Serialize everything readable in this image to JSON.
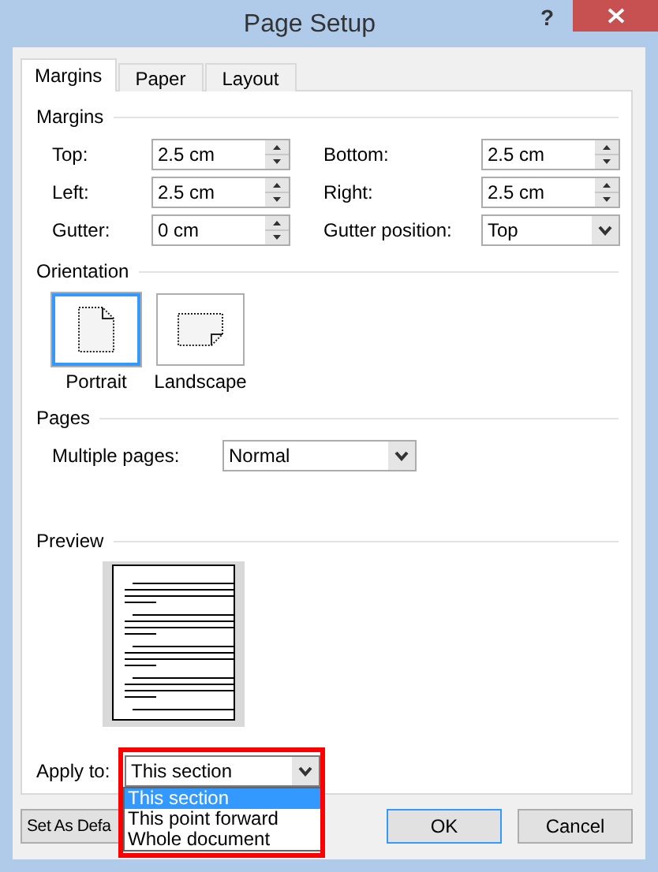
{
  "window": {
    "title": "Page Setup",
    "help": "?"
  },
  "tabs": [
    {
      "label": "Margins",
      "selected": true
    },
    {
      "label": "Paper",
      "selected": false
    },
    {
      "label": "Layout",
      "selected": false
    }
  ],
  "margins": {
    "title": "Margins",
    "fields": [
      {
        "label": "Top:",
        "value": "2.5 cm",
        "kind": "spin"
      },
      {
        "label": "Bottom:",
        "value": "2.5 cm",
        "kind": "spin"
      },
      {
        "label": "Left:",
        "value": "2.5 cm",
        "kind": "spin"
      },
      {
        "label": "Right:",
        "value": "2.5 cm",
        "kind": "spin"
      },
      {
        "label": "Gutter:",
        "value": "0 cm",
        "kind": "spin"
      },
      {
        "label": "Gutter position:",
        "value": "Top",
        "kind": "select"
      }
    ]
  },
  "orientation": {
    "title": "Orientation",
    "options": [
      {
        "label": "Portrait",
        "kind": "portrait",
        "selected": true
      },
      {
        "label": "Landscape",
        "kind": "landscape",
        "selected": false
      }
    ]
  },
  "pages": {
    "title": "Pages",
    "label": "Multiple pages:",
    "value": "Normal"
  },
  "preview": {
    "title": "Preview"
  },
  "apply_to": {
    "label": "Apply to:",
    "value": "This section",
    "open": true,
    "highlighted": true,
    "options": [
      {
        "label": "This section",
        "selected": true
      },
      {
        "label": "This point forward",
        "selected": false
      },
      {
        "label": "Whole document",
        "selected": false
      }
    ]
  },
  "buttons": [
    {
      "label": "Set As Defa",
      "kind": "default"
    },
    {
      "label": "OK",
      "kind": "primary"
    },
    {
      "label": "Cancel",
      "kind": "normal"
    }
  ]
}
